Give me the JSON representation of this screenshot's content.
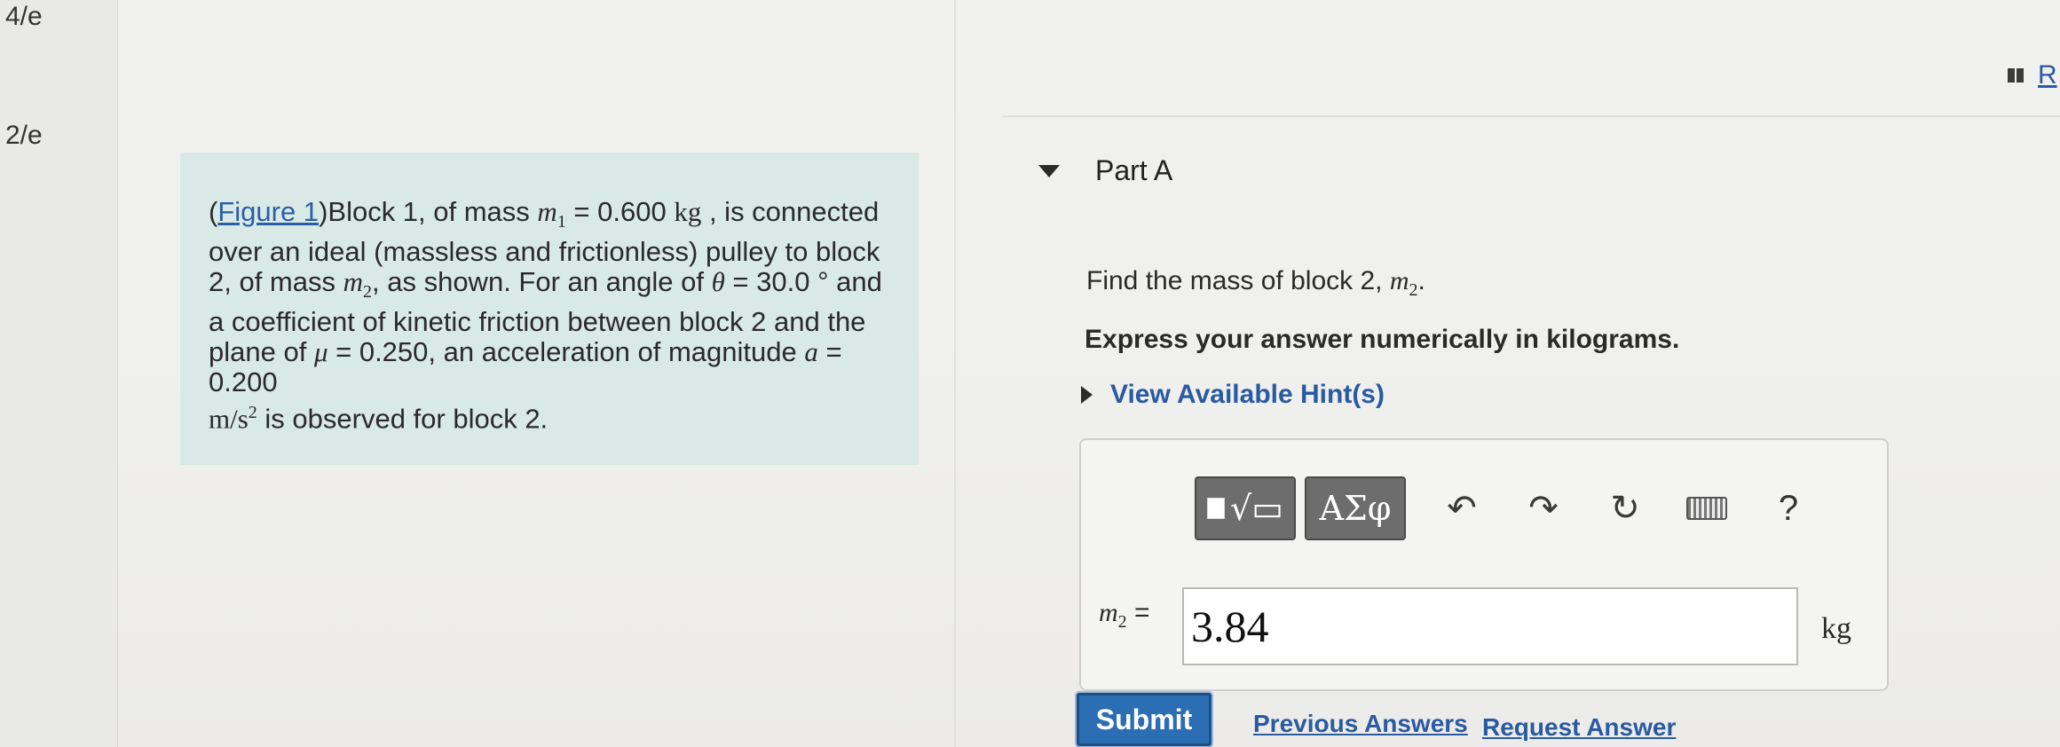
{
  "sidebar": {
    "scores": [
      "4/e",
      "2/e"
    ]
  },
  "problem": {
    "figure_link": "Figure 1",
    "text_1": "(",
    "text_2": ")Block 1, of mass ",
    "m1_symbol": "m",
    "m1_sub": "1",
    "m1_value": " = 0.600 ",
    "m1_unit": "kg",
    "text_3": " , is connected over an ideal (massless and frictionless) pulley to block 2, of mass ",
    "m2_symbol": "m",
    "m2_sub": "2",
    "text_4": ", as shown. For an angle of ",
    "theta_symbol": "θ",
    "theta_value": " = 30.0 °",
    "text_5": " and a coefficient of kinetic friction between block 2 and the plane of ",
    "mu_symbol": "μ",
    "mu_value": " = 0.250",
    "text_6": ", an acceleration of magnitude ",
    "a_symbol": "a",
    "a_value": " = 0.200",
    "a_unit": "m/s",
    "a_unit_exp": "2",
    "text_7": " is observed for block 2."
  },
  "part": {
    "title": "Part A",
    "question_prefix": "Find the mass of block 2, ",
    "question_symbol": "m",
    "question_sub": "2",
    "question_suffix": ".",
    "instruction": "Express your answer numerically in kilograms.",
    "hint_label": "View Available Hint(s)"
  },
  "toolbar": {
    "templates_icon": "templates-radical-icon",
    "greek_label": "ΑΣφ",
    "undo_icon": "undo-icon",
    "redo_icon": "redo-icon",
    "reset_icon": "reset-icon",
    "keyboard_icon": "keyboard-icon",
    "help_label": "?"
  },
  "answer": {
    "var_symbol": "m",
    "var_sub": "2",
    "equals": " =",
    "value": "3.84",
    "unit": "kg"
  },
  "actions": {
    "submit_label": "Submit",
    "previous_answers_label": "Previous Answers",
    "request_answer_label": "Request Answer"
  },
  "corner": {
    "text": "R"
  },
  "colors": {
    "panel_bg": "#d9e9e5",
    "link": "#2a5aa0",
    "submit": "#2c6eb3",
    "toolbar_btn": "#6d6d6d"
  }
}
